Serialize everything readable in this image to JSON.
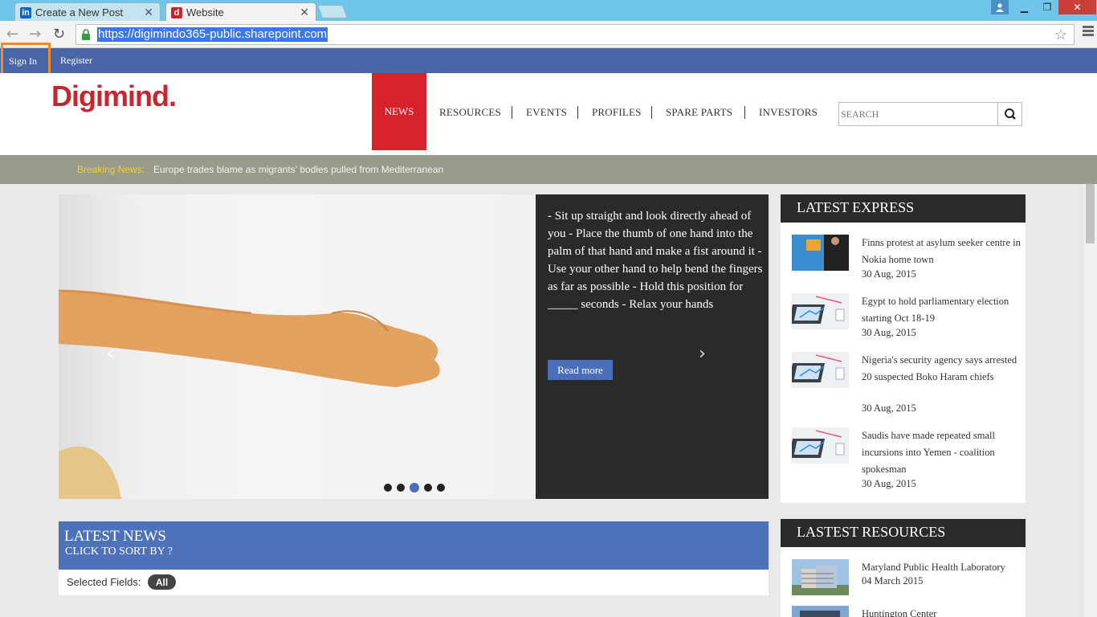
{
  "browser": {
    "tabs": [
      {
        "label": "Create a New Post",
        "favicon": "in"
      },
      {
        "label": "Website",
        "favicon": "d"
      }
    ],
    "url": "https://digimindo365-public.sharepoint.com"
  },
  "topbar": {
    "signin": "Sign In",
    "register": "Register"
  },
  "header": {
    "logo": "Digimind.",
    "nav": [
      "NEWS",
      "RESOURCES",
      "EVENTS",
      "PROFILES",
      "SPARE PARTS",
      "INVESTORS"
    ],
    "search_placeholder": "SEARCH"
  },
  "breaking": {
    "label": "Breaking News:",
    "text": "Europe trades blame as migrants' bodies pulled from Mediterranean"
  },
  "slider": {
    "text": "- Sit up straight and look directly ahead of you - Place the thumb of one hand into the palm of that hand and make a fist around it - Use your other hand to help bend the fingers as far as possible - Hold this position for _____ seconds - Relax your hands",
    "read_more": "Read more",
    "prev": "‹",
    "next": "›",
    "dots": 5,
    "active_dot": 3
  },
  "latest_news": {
    "title": "LATEST NEWS",
    "subtitle": "CLICK TO SORT BY ?",
    "selected_label": "Selected Fields:",
    "selected_value": "All"
  },
  "latest_express": {
    "title": "LATEST EXPRESS",
    "items": [
      {
        "title": "Finns protest at asylum seeker centre in Nokia home town",
        "date": "30 Aug, 2015"
      },
      {
        "title": "Egypt to hold parliamentary election starting Oct 18-19",
        "date": "30 Aug, 2015"
      },
      {
        "title": "Nigeria's security agency says arrested 20 suspected Boko Haram chiefs",
        "date": "30 Aug, 2015"
      },
      {
        "title": "Saudis have made repeated small incursions into Yemen - coalition spokesman",
        "date": "30 Aug, 2015"
      }
    ]
  },
  "latest_resources": {
    "title": "LASTEST RESOURCES",
    "items": [
      {
        "title": "Maryland Public Health Laboratory",
        "date": "04 March 2015"
      },
      {
        "title": "Huntington Center",
        "date": ""
      }
    ]
  },
  "colors": {
    "topbar": "#4a65a8",
    "nav_active": "#d9212b",
    "breaking_label": "#f2d22e",
    "accent_blue": "#4d72b9"
  }
}
